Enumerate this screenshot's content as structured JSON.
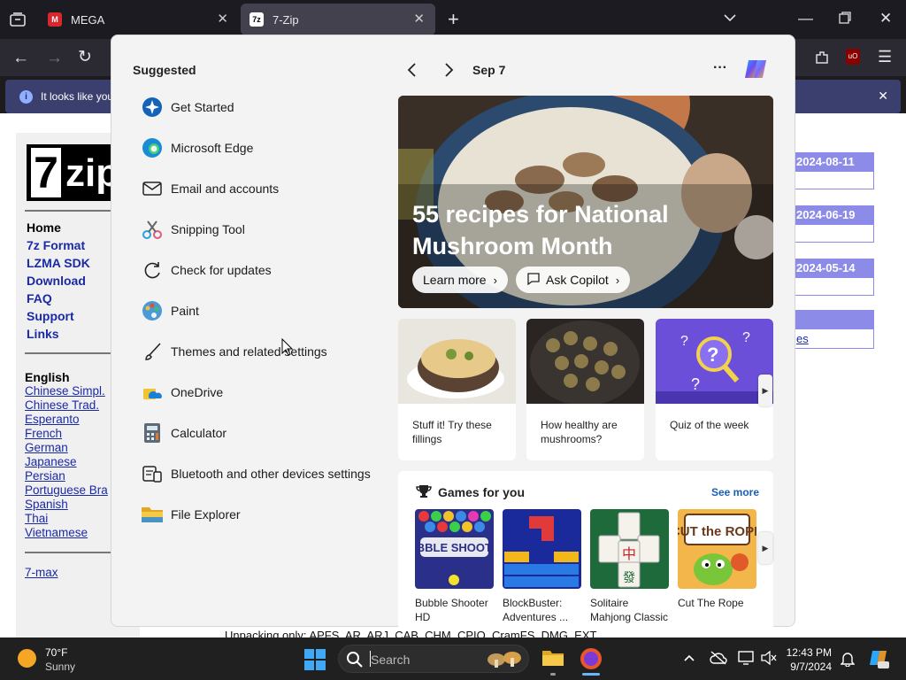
{
  "browser": {
    "tabs": [
      {
        "label": "MEGA",
        "icon": "mega-icon"
      },
      {
        "label": "7-Zip",
        "icon": "7zip-icon"
      }
    ],
    "notice_text": "It looks like you"
  },
  "site": {
    "logo_text": "7zip",
    "nav": [
      "Home",
      "7z Format",
      "LZMA SDK",
      "Download",
      "FAQ",
      "Support",
      "Links"
    ],
    "languages_heading": "English",
    "languages": [
      "Chinese Simpl.",
      "Chinese Trad.",
      "Esperanto",
      "French",
      "German",
      "Japanese",
      "Persian",
      "Portuguese Bra",
      "Spanish",
      "Thai",
      "Vietnamese"
    ],
    "footer_link": "7-max",
    "news_dates": [
      "2024-08-11",
      "2024-06-19",
      "2024-05-14"
    ],
    "news_link_fragment": "es",
    "bottom_text": "Unpacking only: APFS, AR, ARJ, CAB, CHM, CPIO, CramFS, DMG, EXT,"
  },
  "panel": {
    "suggested_title": "Suggested",
    "date": "Sep 7",
    "more_label": "···",
    "suggested": [
      {
        "label": "Get Started",
        "icon": "get-started-icon"
      },
      {
        "label": "Microsoft Edge",
        "icon": "edge-icon"
      },
      {
        "label": "Email and accounts",
        "icon": "mail-icon"
      },
      {
        "label": "Snipping Tool",
        "icon": "snipping-tool-icon"
      },
      {
        "label": "Check for updates",
        "icon": "refresh-icon"
      },
      {
        "label": "Paint",
        "icon": "paint-icon"
      },
      {
        "label": "Themes and related settings",
        "icon": "brush-icon"
      },
      {
        "label": "OneDrive",
        "icon": "onedrive-icon"
      },
      {
        "label": "Calculator",
        "icon": "calculator-icon"
      },
      {
        "label": "Bluetooth and other devices settings",
        "icon": "devices-icon"
      },
      {
        "label": "File Explorer",
        "icon": "folder-icon"
      }
    ],
    "hero": {
      "title_line1": "55 recipes for National",
      "title_line2": "Mushroom Month",
      "learn_more": "Learn more",
      "ask_copilot": "Ask Copilot"
    },
    "cards": [
      {
        "line1": "Stuff it! Try these",
        "line2": "fillings"
      },
      {
        "line1": "How healthy are",
        "line2": "mushrooms?"
      },
      {
        "line1": "Quiz of the week",
        "line2": ""
      }
    ],
    "games": {
      "title": "Games for you",
      "see_more": "See more",
      "items": [
        {
          "line1": "Bubble Shooter",
          "line2": "HD",
          "art": "BUBBLE SHOOTER"
        },
        {
          "line1": "BlockBuster:",
          "line2": "Adventures ...",
          "art": ""
        },
        {
          "line1": "Solitaire",
          "line2": "Mahjong Classic",
          "art": ""
        },
        {
          "line1": "Cut The Rope",
          "line2": "",
          "art": "CUT the ROPE"
        }
      ]
    }
  },
  "taskbar": {
    "temperature": "70°F",
    "condition": "Sunny",
    "search_placeholder": "Search",
    "time": "12:43 PM",
    "date": "9/7/2024"
  }
}
